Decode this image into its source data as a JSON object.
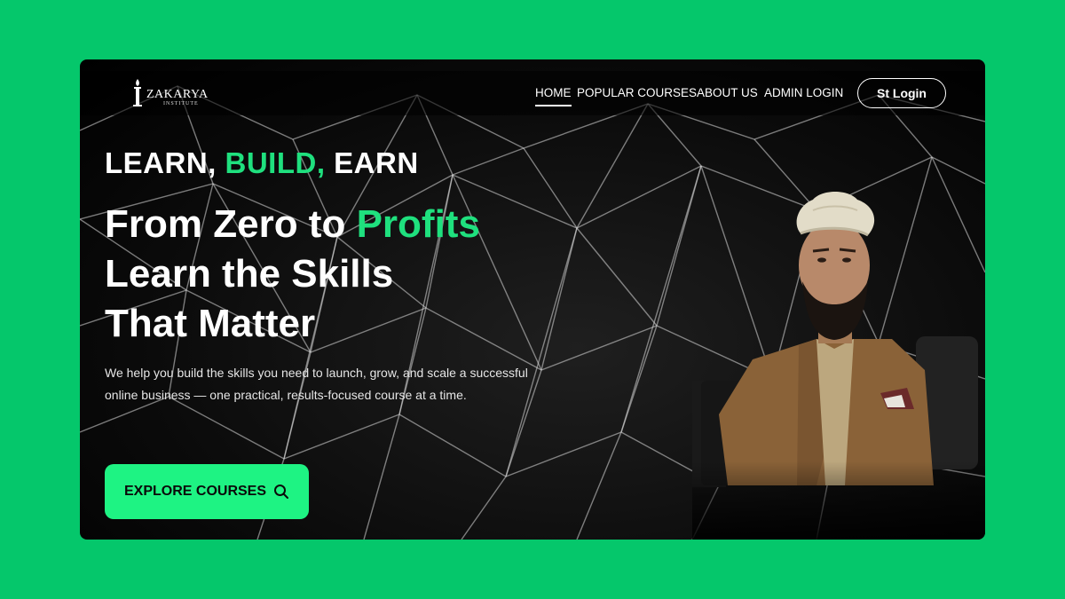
{
  "brand": {
    "name": "ZAKARYA",
    "subtitle": "INSTITUTE"
  },
  "nav": {
    "home": "HOME",
    "popular_courses": "POPULAR COURSES",
    "about_us": "ABOUT US",
    "admin_login": "ADMIN LOGIN",
    "login_button": "St Login"
  },
  "hero": {
    "tagline_part1": "LEARN, ",
    "tagline_part2": "BUILD, ",
    "tagline_part3": "EARN",
    "headline_part1": "From Zero to ",
    "headline_part2": "Profits",
    "headline_line2": "Learn the Skills",
    "headline_line3": "That Matter",
    "description": "We help you build the skills you need to launch, grow, and scale a successful online business — one practical, results-focused course at a time.",
    "cta_label": "EXPLORE COURSES"
  },
  "icons": {
    "search": "search-icon",
    "logo": "torch-logo-icon"
  },
  "colors": {
    "background": "#05c76b",
    "accent": "#1fe07e",
    "button": "#1ef383",
    "frame": "#0b0b0b"
  }
}
